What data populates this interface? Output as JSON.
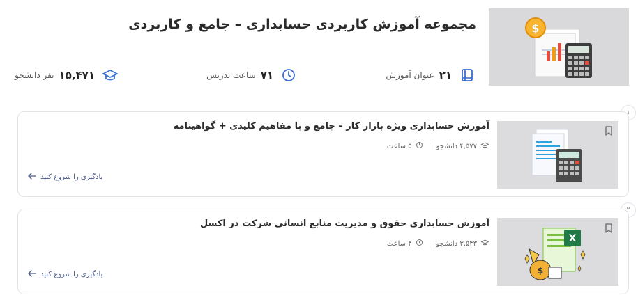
{
  "collection": {
    "title": "مجموعه آموزش کاربردی حسابداری – جامع و کاربردی",
    "stats": {
      "courses": {
        "value": "۲۱",
        "label": "عنوان آموزش",
        "icon": "book-icon"
      },
      "hours": {
        "value": "۷۱",
        "label": "ساعت تدریس",
        "icon": "clock-icon"
      },
      "students": {
        "value": "۱۵,۴۷۱",
        "label": "نفر دانشجو",
        "icon": "graduation-cap-icon"
      }
    }
  },
  "courses": [
    {
      "index": "۱",
      "title": "آموزش حسابداری ویژه بازار کار – جامع و با مفاهیم کلیدی + گواهینامه",
      "students": "۴,۵۷۷ دانشجو",
      "duration": "۵ ساعت",
      "start_label": "یادگیری را شروع کنید"
    },
    {
      "index": "۲",
      "title": "آموزش حسابداری حقوق و مدیریت منابع انسانی شرکت در اکسل",
      "students": "۳,۵۴۳ دانشجو",
      "duration": "۴ ساعت",
      "start_label": "یادگیری را شروع کنید"
    }
  ],
  "colors": {
    "accent": "#3b6fd8",
    "icon_bg": "#e7eefc",
    "border": "#e3e3e7"
  }
}
